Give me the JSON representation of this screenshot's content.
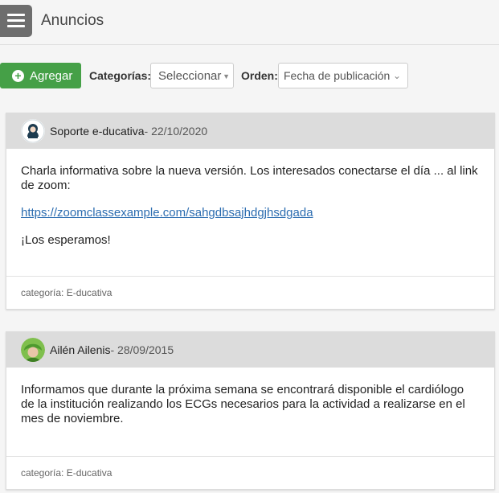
{
  "header": {
    "title": "Anuncios"
  },
  "toolbar": {
    "add_label": "Agregar",
    "categories_label": "Categorías:",
    "categories_value": "Seleccionar",
    "order_label": "Orden:",
    "order_value": "Fecha de publicación"
  },
  "announcements": [
    {
      "author": "Soporte e-ducativa",
      "date": " - 22/10/2020",
      "paragraph1": "Charla informativa sobre la nueva versión. Los interesados conectarse el día ... al link de zoom:",
      "link": "https://zoomclassexample.com/sahgdbsajhdgjhsdgada",
      "paragraph2": "¡Los esperamos!",
      "category": "categoría: E-ducativa",
      "avatar_icon": "support-avatar-icon"
    },
    {
      "author": "Ailén Ailenis",
      "date": " - 28/09/2015",
      "paragraph1": "Informamos que durante la próxima semana se encontrará disponible el cardiólogo de la institución realizando los ECGs necesarios para la actividad a realizarse en el mes de noviembre.",
      "category": "categoría: E-ducativa",
      "avatar_icon": "user-avatar-icon"
    }
  ],
  "colors": {
    "accent": "#45a047",
    "link": "#2b6cb0",
    "menu": "#6e6e6e"
  }
}
